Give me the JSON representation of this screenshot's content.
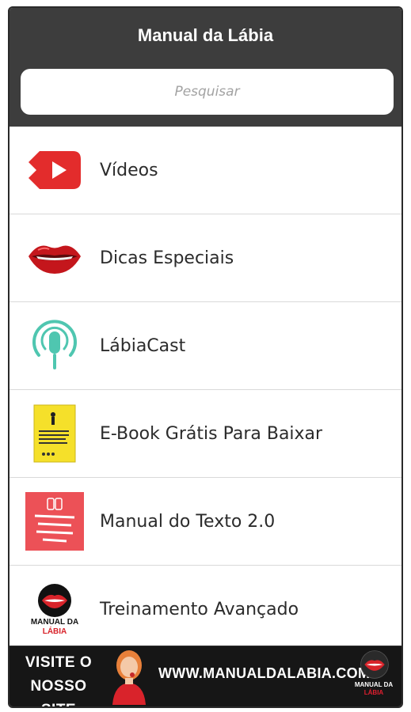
{
  "app": {
    "title": "Manual da Lábia"
  },
  "search": {
    "placeholder": "Pesquisar"
  },
  "menu": {
    "items": [
      {
        "label": "Vídeos",
        "icon": "youtube-play-icon"
      },
      {
        "label": "Dicas Especiais",
        "icon": "lips-icon"
      },
      {
        "label": "LábiaCast",
        "icon": "podcast-microphone-icon"
      },
      {
        "label": "E-Book Grátis Para Baixar",
        "icon": "ebook-cover-icon"
      },
      {
        "label": "Manual do Texto 2.0",
        "icon": "manual-texto-cover-icon"
      },
      {
        "label": "Treinamento Avançado",
        "icon": "manual-da-labia-logo-icon"
      }
    ]
  },
  "logo": {
    "line1": "MANUAL DA",
    "line2": "LÁBIA"
  },
  "banner": {
    "cta_line1": "VISITE O",
    "cta_line2": "NOSSO SITE",
    "url": "WWW.MANUALDALABIA.COM",
    "logo_line1": "MANUAL DA",
    "logo_line2": "LÁBIA"
  },
  "colors": {
    "header_bg": "#3d3d3d",
    "accent_red": "#e01f2f",
    "teal": "#4fc6b0"
  }
}
